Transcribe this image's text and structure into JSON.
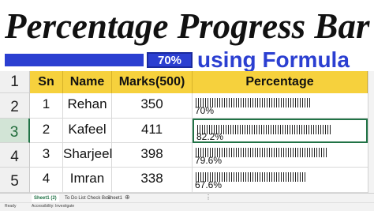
{
  "title": "Percentage Progress Bar",
  "banner": {
    "percent_label": "70%",
    "subtitle": "using Formula"
  },
  "columns": [
    "Sn",
    "Name",
    "Marks(500)",
    "Percentage"
  ],
  "row_numbers": [
    "1",
    "2",
    "3",
    "4",
    "5"
  ],
  "rows": [
    {
      "sn": "1",
      "name": "Rehan",
      "marks": "350",
      "percent": "70%",
      "fraction": 0.7
    },
    {
      "sn": "2",
      "name": "Kafeel",
      "marks": "411",
      "percent": "82.2%",
      "fraction": 0.822
    },
    {
      "sn": "3",
      "name": "Sharjeel",
      "marks": "398",
      "percent": "79.6%",
      "fraction": 0.796
    },
    {
      "sn": "4",
      "name": "Imran",
      "marks": "338",
      "percent": "67.6%",
      "fraction": 0.676
    }
  ],
  "sheet_tabs": [
    "Sheet1 (2)",
    "To Do List Check Box",
    "Sheet1"
  ],
  "status_bar": {
    "ready": "Ready",
    "accessibility": "Accessibility: Investigate"
  },
  "colors": {
    "header_fill": "#f6d13d",
    "banner_blue": "#2b3fd1",
    "excel_green": "#217346"
  }
}
